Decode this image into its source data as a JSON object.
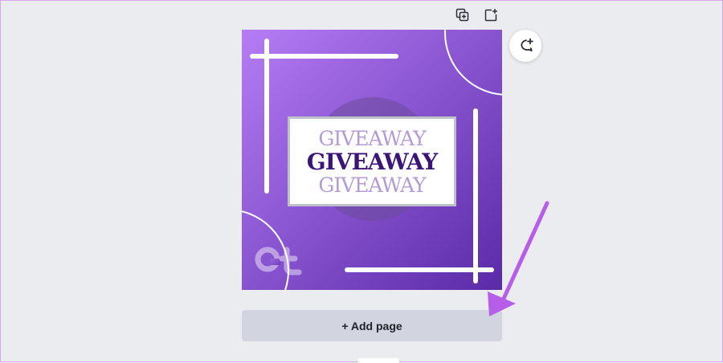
{
  "toolbar": {
    "duplicate_icon": "duplicate-page-icon",
    "add_icon": "add-page-icon"
  },
  "design": {
    "lines": [
      "GIVEAWAY",
      "GIVEAWAY",
      "GIVEAWAY"
    ],
    "logo": "Gt",
    "colors": {
      "gradient_start": "#b57cf5",
      "gradient_end": "#5a2aa8",
      "text_light": "#b49bd6",
      "text_dark": "#3b1576"
    }
  },
  "comment": {
    "icon": "add-comment-icon"
  },
  "add_page": {
    "label": "+ Add page"
  },
  "annotation": {
    "arrow_color": "#b65ee8"
  }
}
